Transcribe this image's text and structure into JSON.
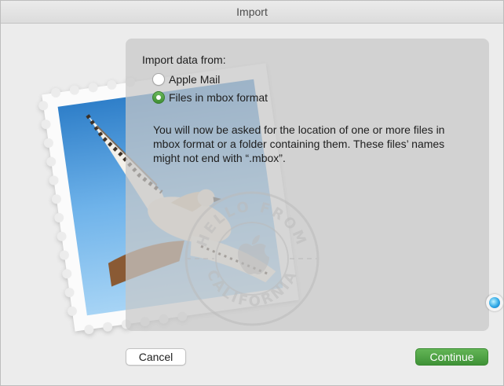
{
  "window": {
    "title": "Import"
  },
  "import": {
    "heading": "Import data from:",
    "options": [
      {
        "label": "Apple Mail",
        "selected": false
      },
      {
        "label": "Files in mbox format",
        "selected": true
      }
    ],
    "description": "You will now be asked for the location of one or more files in mbox format or a folder containing them. These files’ names might not end with “.mbox”."
  },
  "postmark": {
    "text": "HELLO FROM CALIFORNIA"
  },
  "buttons": {
    "cancel": "Cancel",
    "continue": "Continue"
  },
  "colors": {
    "accent": "#4ea843",
    "panel": "#c8c8c8",
    "window": "#ececec"
  },
  "icons": {
    "stamp": "mail-stamp-hawk",
    "postmark": "apple-logo",
    "siri": "siri-icon"
  }
}
